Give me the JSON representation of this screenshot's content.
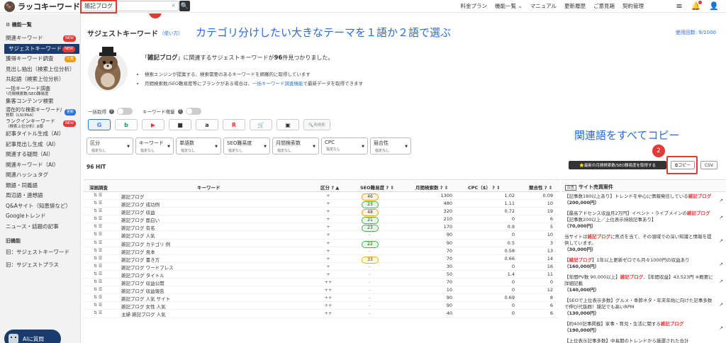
{
  "logo": {
    "text": "ラッコキーワード"
  },
  "search": {
    "value": "雑記ブログ",
    "clear": "×",
    "button": "🔍"
  },
  "nav": [
    "料金プラン",
    "機能一覧 ⌄",
    "マニュアル",
    "更新履歴",
    "ご意見箱",
    "契約管理"
  ],
  "top_icons": [
    "≡",
    "🔔",
    "👤"
  ],
  "sidebar": {
    "head": "⚙ 機能一覧",
    "items": [
      {
        "label": "関連キーワード",
        "badge": "NEW",
        "badge_color": "red"
      },
      {
        "label": "サジェストキーワード",
        "badge": "NEW",
        "badge_color": "red",
        "active": true
      },
      {
        "label": "獲得キーワード調査",
        "badge": "人気",
        "badge_color": "orange"
      },
      {
        "label": "見出し抽出（検索上位分析）"
      },
      {
        "label": "共起語（検索上位分析）"
      },
      {
        "label": "一括キーワード調査",
        "sub": "└月間検索数/SEO難易度",
        "two": true
      },
      {
        "label": "集客コンテンツ検索"
      },
      {
        "label": "潜在的な検索キーワード/",
        "sub": "質問（LSI/PAA）",
        "badge": "更新",
        "badge_color": "blue",
        "two": true
      },
      {
        "label": "ランクインキーワード",
        "sub": "（検索上位分析）β版",
        "badge": "NEW",
        "badge_color": "red",
        "two": true
      },
      {
        "label": "記事タイトル生成（AI）"
      },
      {
        "label": "記事見出し生成（AI）"
      },
      {
        "label": "関連する疑問（AI）"
      },
      {
        "label": "関連キーワード（AI）"
      },
      {
        "label": "関連ハッシュタグ"
      },
      {
        "label": "類語・同義語"
      },
      {
        "label": "周辺語・連想語"
      },
      {
        "label": "Q&Aサイト（知恵袋など）"
      },
      {
        "label": "Googleトレンド"
      },
      {
        "label": "ニュース・話題の記事"
      }
    ],
    "old_section": "旧機能",
    "old_items": [
      "旧：サジェストキーワード",
      "旧：サジェストプラス"
    ],
    "ai_button": "AIに質問"
  },
  "main": {
    "title": "サジェストキーワード",
    "howto": "（使い方）",
    "usage": "使用回数: 9/1000",
    "hero_pre": "「",
    "hero_kw": "雑記ブログ",
    "hero_mid": "」に関連するサジェストキーワードが",
    "hero_count": "96",
    "hero_post": "件見つかりました。",
    "bullet1": "検索エンジンが提案する、検索需要のあるキーワードを網羅的に取得しています",
    "bullet2_pre": "月間検索数/SEO難易度等にブランクがある場合は、",
    "bullet2_link": "一括キーワード調査機能",
    "bullet2_post": "で最新データを取得できます",
    "toggle1": "一括取得",
    "toggle2": "キーワード増量",
    "engine_icons": [
      "G",
      "b",
      "▶",
      "■",
      "a",
      "R",
      "🛒",
      "▣"
    ],
    "engine_colors": [
      "#4285f4",
      "#1a9a6a",
      "#e53935",
      "#333",
      "#333",
      "#e53935",
      "#333",
      "#333"
    ],
    "research_btn": "🔍再検索",
    "filters": [
      {
        "name": "区分",
        "val": "指定なし",
        "w": 66
      },
      {
        "name": "キーワード",
        "val": "指定なし",
        "w": 54
      },
      {
        "name": "単語数",
        "val": "指定なし",
        "w": 64
      },
      {
        "name": "SEO難易度",
        "val": "指定なし",
        "w": 66
      },
      {
        "name": "月間検索数",
        "val": "指定なし",
        "w": 66
      },
      {
        "name": "CPC",
        "val": "指定なし",
        "w": 66
      },
      {
        "name": "競合性",
        "val": "指定なし",
        "w": 58
      }
    ],
    "hit": "96 HIT",
    "btn_latest": "⭐最新の月間検索数/SEO難易度を取得する",
    "btn_copy": "⧉コピー",
    "btn_csv": "CSV"
  },
  "annotations": {
    "a1_num": "1",
    "a1_text": "カテゴリ分けしたい大きなテーマを１語か２語で選ぶ",
    "a2_num": "2",
    "a2_text": "関連語をすべてコピー"
  },
  "table": {
    "headers": {
      "dig": "深掘調査",
      "kw": "キーワード",
      "div": "区分 ? ▲",
      "seo": "SEO難易度 ? ⇕",
      "vol": "月間検索数 ? ⇕",
      "cpc": "CPC（$） ? ⇕",
      "comp": "競合性 ? ⇕"
    },
    "rows": [
      {
        "kw": "雑記ブログ",
        "div": "+",
        "seo": "46",
        "seo_c": "orange",
        "vol": "1300",
        "cpc": "1.02",
        "comp": "0.09"
      },
      {
        "kw": "雑記ブログ 成功例",
        "div": "+",
        "seo": "23",
        "seo_c": "green",
        "vol": "480",
        "cpc": "1.11",
        "comp": "10"
      },
      {
        "kw": "雑記ブログ 収益",
        "div": "+",
        "seo": "48",
        "seo_c": "orange",
        "vol": "320",
        "cpc": "0.72",
        "comp": "19"
      },
      {
        "kw": "雑記ブログ 面白い",
        "div": "+",
        "seo": "21",
        "seo_c": "green",
        "vol": "210",
        "cpc": "0",
        "comp": "6"
      },
      {
        "kw": "雑記ブログ 有名",
        "div": "+",
        "seo": "23",
        "seo_c": "green",
        "vol": "170",
        "cpc": "0.9",
        "comp": "5"
      },
      {
        "kw": "雑記ブログ 人気",
        "div": "+",
        "seo": "-",
        "seo_c": "",
        "vol": "90",
        "cpc": "0",
        "comp": "10"
      },
      {
        "kw": "雑記ブログ カテゴリ 例",
        "div": "+",
        "seo": "22",
        "seo_c": "green",
        "vol": "90",
        "cpc": "0.5",
        "comp": "3"
      },
      {
        "kw": "雑記ブログ 見本",
        "div": "+",
        "seo": "-",
        "seo_c": "",
        "vol": "70",
        "cpc": "0.58",
        "comp": "13"
      },
      {
        "kw": "雑記ブログ 書き方",
        "div": "+",
        "seo": "33",
        "seo_c": "yellow",
        "vol": "70",
        "cpc": "0.66",
        "comp": "14"
      },
      {
        "kw": "雑記ブログ ワードプレス",
        "div": "+",
        "seo": "-",
        "seo_c": "",
        "vol": "30",
        "cpc": "0",
        "comp": "16"
      },
      {
        "kw": "雑記ブログ タイトル",
        "div": "+",
        "seo": "-",
        "seo_c": "",
        "vol": "50",
        "cpc": "1.4",
        "comp": "11"
      },
      {
        "kw": "雑記ブログ 収益公開",
        "div": "++",
        "seo": "-",
        "seo_c": "",
        "vol": "70",
        "cpc": "0",
        "comp": "0"
      },
      {
        "kw": "雑記ブログ 収益報告",
        "div": "++",
        "seo": "-",
        "seo_c": "",
        "vol": "10",
        "cpc": "0",
        "comp": "12"
      },
      {
        "kw": "雑記ブログ 人気 サイト",
        "div": "++",
        "seo": "-",
        "seo_c": "",
        "vol": "90",
        "cpc": "0.69",
        "comp": "8"
      },
      {
        "kw": "雑記ブログ 女性 人気",
        "div": "++",
        "seo": "-",
        "seo_c": "",
        "vol": "90",
        "cpc": "0",
        "comp": "6"
      },
      {
        "kw": "主婦 雑記ブログ 人気",
        "div": "++",
        "seo": "-",
        "seo_c": "",
        "vol": "40",
        "cpc": "0",
        "comp": "6"
      }
    ]
  },
  "ads": {
    "head_tag": "広告",
    "head": "サイト売買案件",
    "items": [
      {
        "pre": "【記事数180以上あり】トレンドを中心に情報発信している",
        "hl": "雑記ブログ",
        "post": "",
        "price": "（200,000円）"
      },
      {
        "pre": "【最高アドセンス収益月2万円】イベント・ライブメインの",
        "hl": "雑記ブログ",
        "post": "【記事数200以上／上位表示持続記事あり】",
        "price": "（70,000円）"
      },
      {
        "pre": "当サイトは",
        "hl": "雑記ブログ",
        "post": "に焦点を当て、その領域での深い知識と情報を提供しています。",
        "price": "（30,000円）"
      },
      {
        "pre": "【",
        "hl": "雑記ブログ",
        "post": "】1年以上更新ゼロでも月々1000円の収益あり",
        "price": "（160,000円）"
      },
      {
        "pre": "【年間PV数 90,000以上】",
        "hl": "雑記ブログ",
        "post": "、【年間収益】43,523円 ※概要に詳細記載",
        "price": "（140,000円）"
      },
      {
        "pre": "【SEOで上位表示多数】グルメ・季節ネタ・年末年始に向けた記事多数で伸び代抜群！雑記でも高いRPM",
        "hl": "",
        "post": "",
        "price": "（130,000円）"
      },
      {
        "pre": "【約400記事掲載】家事・育児・生活に関する",
        "hl": "雑記ブログ",
        "post": "",
        "price": "（190,000円）"
      },
      {
        "pre": "【上位表示記事多数】中長期のトレンドから厳選された合計",
        "hl": "",
        "post": "",
        "price": ""
      }
    ]
  }
}
